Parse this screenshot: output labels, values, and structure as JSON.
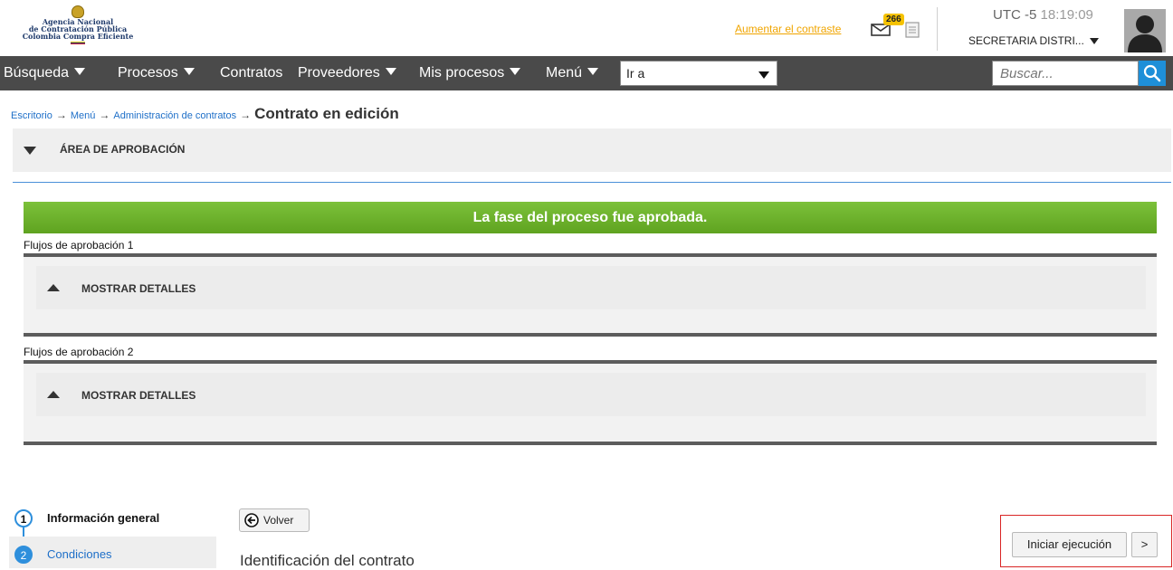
{
  "header": {
    "logo": {
      "line1": "Agencia Nacional",
      "line2": "de Contratación Pública",
      "line3": "Colombia Compra Eficiente"
    },
    "contrast_link": "Aumentar el contraste",
    "mail_count": "266",
    "timezone": "UTC -5",
    "time": "18:19:09",
    "user": "SECRETARIA DISTRI..."
  },
  "nav": {
    "items": [
      {
        "label": "Búsqueda",
        "dropdown": true
      },
      {
        "label": "Procesos",
        "dropdown": true
      },
      {
        "label": "Contratos",
        "dropdown": false
      },
      {
        "label": "Proveedores",
        "dropdown": true
      },
      {
        "label": "Mis procesos",
        "dropdown": true
      },
      {
        "label": "Menú",
        "dropdown": true
      }
    ],
    "goto_value": "Ir a",
    "search_placeholder": "Buscar..."
  },
  "breadcrumb": {
    "items": [
      "Escritorio",
      "Menú",
      "Administración de contratos"
    ],
    "current": "Contrato en edición"
  },
  "approval": {
    "header_label": "ÁREA DE APROBACIÓN",
    "banner": "La fase del proceso fue aprobada.",
    "flows": [
      {
        "label": "Flujos de aprobación 1",
        "toggle": "MOSTRAR DETALLES"
      },
      {
        "label": "Flujos de aprobación 2",
        "toggle": "MOSTRAR DETALLES"
      }
    ]
  },
  "steps": [
    {
      "number": "1",
      "label": "Información general"
    },
    {
      "number": "2",
      "label": "Condiciones"
    }
  ],
  "actions": {
    "back": "Volver",
    "start": "Iniciar ejecución",
    "next": ">"
  },
  "section_title": "Identificación del contrato",
  "colors": {
    "nav_bg": "#4a4a4a",
    "success": "#6db32a",
    "accent": "#2e8fdc",
    "link": "#1e6fc8",
    "highlight_frame": "#d92525"
  }
}
